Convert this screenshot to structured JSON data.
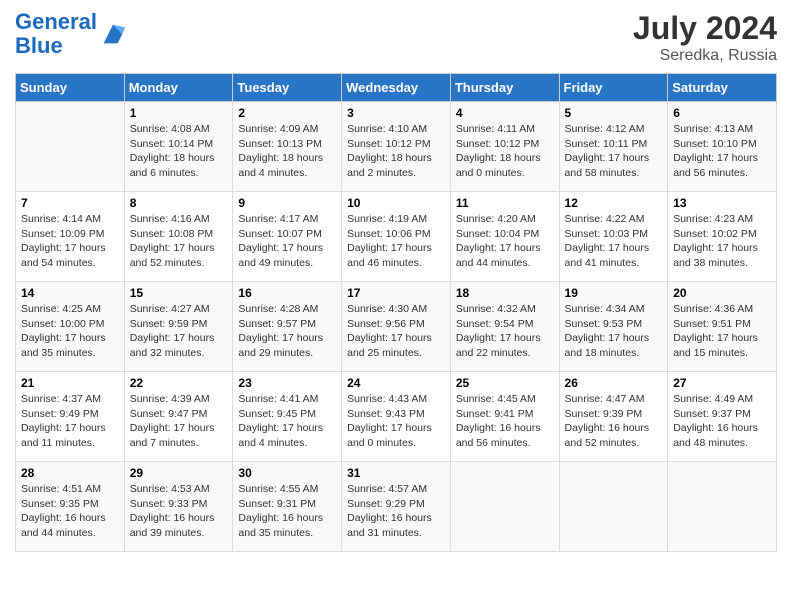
{
  "header": {
    "logo_text_general": "General",
    "logo_text_blue": "Blue",
    "month": "July 2024",
    "location": "Seredka, Russia"
  },
  "weekdays": [
    "Sunday",
    "Monday",
    "Tuesday",
    "Wednesday",
    "Thursday",
    "Friday",
    "Saturday"
  ],
  "weeks": [
    [
      {
        "day": "",
        "content": ""
      },
      {
        "day": "1",
        "content": "Sunrise: 4:08 AM\nSunset: 10:14 PM\nDaylight: 18 hours\nand 6 minutes."
      },
      {
        "day": "2",
        "content": "Sunrise: 4:09 AM\nSunset: 10:13 PM\nDaylight: 18 hours\nand 4 minutes."
      },
      {
        "day": "3",
        "content": "Sunrise: 4:10 AM\nSunset: 10:12 PM\nDaylight: 18 hours\nand 2 minutes."
      },
      {
        "day": "4",
        "content": "Sunrise: 4:11 AM\nSunset: 10:12 PM\nDaylight: 18 hours\nand 0 minutes."
      },
      {
        "day": "5",
        "content": "Sunrise: 4:12 AM\nSunset: 10:11 PM\nDaylight: 17 hours\nand 58 minutes."
      },
      {
        "day": "6",
        "content": "Sunrise: 4:13 AM\nSunset: 10:10 PM\nDaylight: 17 hours\nand 56 minutes."
      }
    ],
    [
      {
        "day": "7",
        "content": "Sunrise: 4:14 AM\nSunset: 10:09 PM\nDaylight: 17 hours\nand 54 minutes."
      },
      {
        "day": "8",
        "content": "Sunrise: 4:16 AM\nSunset: 10:08 PM\nDaylight: 17 hours\nand 52 minutes."
      },
      {
        "day": "9",
        "content": "Sunrise: 4:17 AM\nSunset: 10:07 PM\nDaylight: 17 hours\nand 49 minutes."
      },
      {
        "day": "10",
        "content": "Sunrise: 4:19 AM\nSunset: 10:06 PM\nDaylight: 17 hours\nand 46 minutes."
      },
      {
        "day": "11",
        "content": "Sunrise: 4:20 AM\nSunset: 10:04 PM\nDaylight: 17 hours\nand 44 minutes."
      },
      {
        "day": "12",
        "content": "Sunrise: 4:22 AM\nSunset: 10:03 PM\nDaylight: 17 hours\nand 41 minutes."
      },
      {
        "day": "13",
        "content": "Sunrise: 4:23 AM\nSunset: 10:02 PM\nDaylight: 17 hours\nand 38 minutes."
      }
    ],
    [
      {
        "day": "14",
        "content": "Sunrise: 4:25 AM\nSunset: 10:00 PM\nDaylight: 17 hours\nand 35 minutes."
      },
      {
        "day": "15",
        "content": "Sunrise: 4:27 AM\nSunset: 9:59 PM\nDaylight: 17 hours\nand 32 minutes."
      },
      {
        "day": "16",
        "content": "Sunrise: 4:28 AM\nSunset: 9:57 PM\nDaylight: 17 hours\nand 29 minutes."
      },
      {
        "day": "17",
        "content": "Sunrise: 4:30 AM\nSunset: 9:56 PM\nDaylight: 17 hours\nand 25 minutes."
      },
      {
        "day": "18",
        "content": "Sunrise: 4:32 AM\nSunset: 9:54 PM\nDaylight: 17 hours\nand 22 minutes."
      },
      {
        "day": "19",
        "content": "Sunrise: 4:34 AM\nSunset: 9:53 PM\nDaylight: 17 hours\nand 18 minutes."
      },
      {
        "day": "20",
        "content": "Sunrise: 4:36 AM\nSunset: 9:51 PM\nDaylight: 17 hours\nand 15 minutes."
      }
    ],
    [
      {
        "day": "21",
        "content": "Sunrise: 4:37 AM\nSunset: 9:49 PM\nDaylight: 17 hours\nand 11 minutes."
      },
      {
        "day": "22",
        "content": "Sunrise: 4:39 AM\nSunset: 9:47 PM\nDaylight: 17 hours\nand 7 minutes."
      },
      {
        "day": "23",
        "content": "Sunrise: 4:41 AM\nSunset: 9:45 PM\nDaylight: 17 hours\nand 4 minutes."
      },
      {
        "day": "24",
        "content": "Sunrise: 4:43 AM\nSunset: 9:43 PM\nDaylight: 17 hours\nand 0 minutes."
      },
      {
        "day": "25",
        "content": "Sunrise: 4:45 AM\nSunset: 9:41 PM\nDaylight: 16 hours\nand 56 minutes."
      },
      {
        "day": "26",
        "content": "Sunrise: 4:47 AM\nSunset: 9:39 PM\nDaylight: 16 hours\nand 52 minutes."
      },
      {
        "day": "27",
        "content": "Sunrise: 4:49 AM\nSunset: 9:37 PM\nDaylight: 16 hours\nand 48 minutes."
      }
    ],
    [
      {
        "day": "28",
        "content": "Sunrise: 4:51 AM\nSunset: 9:35 PM\nDaylight: 16 hours\nand 44 minutes."
      },
      {
        "day": "29",
        "content": "Sunrise: 4:53 AM\nSunset: 9:33 PM\nDaylight: 16 hours\nand 39 minutes."
      },
      {
        "day": "30",
        "content": "Sunrise: 4:55 AM\nSunset: 9:31 PM\nDaylight: 16 hours\nand 35 minutes."
      },
      {
        "day": "31",
        "content": "Sunrise: 4:57 AM\nSunset: 9:29 PM\nDaylight: 16 hours\nand 31 minutes."
      },
      {
        "day": "",
        "content": ""
      },
      {
        "day": "",
        "content": ""
      },
      {
        "day": "",
        "content": ""
      }
    ]
  ]
}
